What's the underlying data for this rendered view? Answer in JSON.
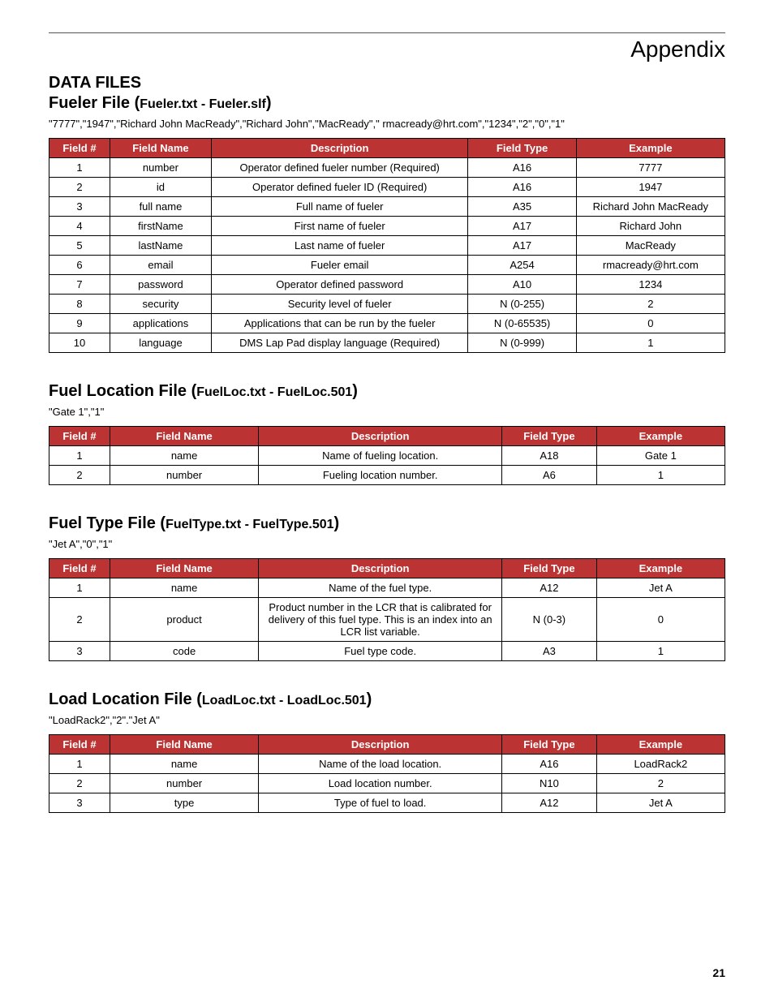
{
  "header": {
    "appendix": "Appendix"
  },
  "data_files_label": "DATA FILES",
  "columns": {
    "num": "Field #",
    "name": "Field Name",
    "desc": "Description",
    "type": "Field Type",
    "ex": "Example"
  },
  "sections": [
    {
      "title_main": "Fueler File (",
      "title_sub": "Fueler.txt - Fueler.slf",
      "title_close": ")",
      "example": "\"7777\",\"1947\",\"Richard John MacReady\",\"Richard John\",\"MacReady\",\" rmacready@hrt.com\",\"1234\",\"2\",\"0\",\"1\"",
      "rows": [
        {
          "n": "1",
          "name": "number",
          "desc": "Operator defined fueler number (Required)",
          "type": "A16",
          "ex": "7777"
        },
        {
          "n": "2",
          "name": "id",
          "desc": "Operator defined fueler ID (Required)",
          "type": "A16",
          "ex": "1947"
        },
        {
          "n": "3",
          "name": "full name",
          "desc": "Full name of fueler",
          "type": "A35",
          "ex": "Richard John MacReady"
        },
        {
          "n": "4",
          "name": "firstName",
          "desc": "First name of fueler",
          "type": "A17",
          "ex": "Richard John"
        },
        {
          "n": "5",
          "name": "lastName",
          "desc": "Last name of fueler",
          "type": "A17",
          "ex": "MacReady"
        },
        {
          "n": "6",
          "name": "email",
          "desc": "Fueler email",
          "type": "A254",
          "ex": "rmacready@hrt.com"
        },
        {
          "n": "7",
          "name": "password",
          "desc": "Operator defined password",
          "type": "A10",
          "ex": "1234"
        },
        {
          "n": "8",
          "name": "security",
          "desc": "Security level of fueler",
          "type": "N (0-255)",
          "ex": "2"
        },
        {
          "n": "9",
          "name": "applications",
          "desc": "Applications that can be run by the fueler",
          "type": "N (0-65535)",
          "ex": "0"
        },
        {
          "n": "10",
          "name": "language",
          "desc": "DMS Lap Pad display language (Required)",
          "type": "N (0-999)",
          "ex": "1"
        }
      ]
    },
    {
      "title_main": "Fuel Location File (",
      "title_sub": "FuelLoc.txt - FuelLoc.501",
      "title_close": ")",
      "example": "\"Gate 1\",\"1\"",
      "rows": [
        {
          "n": "1",
          "name": "name",
          "desc": "Name of fueling location.",
          "type": "A18",
          "ex": "Gate 1"
        },
        {
          "n": "2",
          "name": "number",
          "desc": "Fueling location number.",
          "type": "A6",
          "ex": "1"
        }
      ]
    },
    {
      "title_main": "Fuel Type File (",
      "title_sub": "FuelType.txt - FuelType.501",
      "title_close": ")",
      "example": "\"Jet A\",\"0\",\"1\"",
      "rows": [
        {
          "n": "1",
          "name": "name",
          "desc": "Name of the fuel type.",
          "type": "A12",
          "ex": "Jet A"
        },
        {
          "n": "2",
          "name": "product",
          "desc": "Product number in the LCR that is calibrated for delivery of this fuel type. This is an index into an LCR list variable.",
          "type": "N (0-3)",
          "ex": "0"
        },
        {
          "n": "3",
          "name": "code",
          "desc": "Fuel type code.",
          "type": "A3",
          "ex": "1"
        }
      ]
    },
    {
      "title_main": "Load Location File (",
      "title_sub": "LoadLoc.txt - LoadLoc.501",
      "title_close": ")",
      "example": "\"LoadRack2\",\"2\".\"Jet A\"",
      "rows": [
        {
          "n": "1",
          "name": "name",
          "desc": "Name of the load location.",
          "type": "A16",
          "ex": "LoadRack2"
        },
        {
          "n": "2",
          "name": "number",
          "desc": "Load location number.",
          "type": "N10",
          "ex": "2"
        },
        {
          "n": "3",
          "name": "type",
          "desc": "Type of fuel to load.",
          "type": "A12",
          "ex": "Jet A"
        }
      ]
    }
  ],
  "page_number": "21"
}
